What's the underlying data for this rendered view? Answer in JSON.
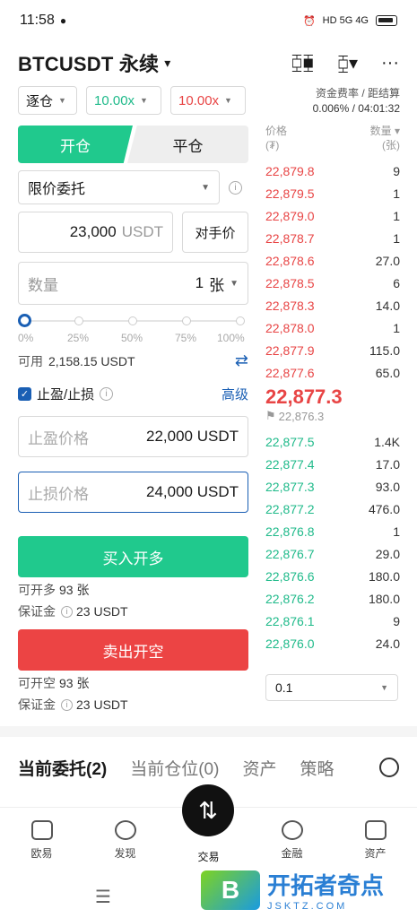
{
  "status_bar": {
    "time": "11:58",
    "indicators": "HD 5G 4G"
  },
  "header": {
    "pair": "BTCUSDT 永续",
    "caret": "▾"
  },
  "margin_mode": "逐仓",
  "leverage_long": "10.00x",
  "leverage_short": "10.00x",
  "tabs": {
    "open": "开仓",
    "close": "平仓"
  },
  "order_type": "限价委托",
  "price": {
    "value": "23,000",
    "unit": "USDT",
    "counter": "对手价"
  },
  "quantity": {
    "placeholder": "数量",
    "value": "1",
    "unit": "张"
  },
  "slider": {
    "labels": [
      "0%",
      "25%",
      "50%",
      "75%",
      "100%"
    ],
    "level": 0
  },
  "available": {
    "label": "可用",
    "value": "2,158.15 USDT"
  },
  "tpsl": {
    "label": "止盈/止损",
    "advanced": "高级"
  },
  "take_profit": {
    "placeholder": "止盈价格",
    "value": "22,000 USDT"
  },
  "stop_loss": {
    "placeholder": "止损价格",
    "value": "24,000 USDT"
  },
  "buy": {
    "label": "买入开多",
    "can_open_label": "可开多",
    "can_open_value": "93 张",
    "margin_label": "保证金",
    "margin_value": "23 USDT"
  },
  "sell": {
    "label": "卖出开空",
    "can_open_label": "可开空",
    "can_open_value": "93 张",
    "margin_label": "保证金",
    "margin_value": "23 USDT"
  },
  "funding": {
    "label": "资金费率 / 距结算",
    "value": "0.006% / 04:01:32"
  },
  "orderbook": {
    "price_header": "价格",
    "price_unit": "(₮)",
    "qty_header": "数量 ▾",
    "qty_unit": "(张)",
    "asks": [
      {
        "p": "22,879.8",
        "q": "9"
      },
      {
        "p": "22,879.5",
        "q": "1"
      },
      {
        "p": "22,879.0",
        "q": "1"
      },
      {
        "p": "22,878.7",
        "q": "1"
      },
      {
        "p": "22,878.6",
        "q": "27.0"
      },
      {
        "p": "22,878.5",
        "q": "6"
      },
      {
        "p": "22,878.3",
        "q": "14.0"
      },
      {
        "p": "22,878.0",
        "q": "1"
      },
      {
        "p": "22,877.9",
        "q": "115.0"
      },
      {
        "p": "22,877.6",
        "q": "65.0"
      }
    ],
    "last_price": "22,877.3",
    "mark_price": "22,876.3",
    "bids": [
      {
        "p": "22,877.5",
        "q": "1.4K"
      },
      {
        "p": "22,877.4",
        "q": "17.0"
      },
      {
        "p": "22,877.3",
        "q": "93.0"
      },
      {
        "p": "22,877.2",
        "q": "476.0"
      },
      {
        "p": "22,876.8",
        "q": "1"
      },
      {
        "p": "22,876.7",
        "q": "29.0"
      },
      {
        "p": "22,876.6",
        "q": "180.0"
      },
      {
        "p": "22,876.2",
        "q": "180.0"
      },
      {
        "p": "22,876.1",
        "q": "9"
      },
      {
        "p": "22,876.0",
        "q": "24.0"
      }
    ],
    "depth": "0.1"
  },
  "bottom_tabs": [
    "当前委托(2)",
    "当前仓位(0)",
    "资产",
    "策略"
  ],
  "nav": [
    "欧易",
    "发现",
    "交易",
    "金融",
    "资产"
  ],
  "watermark": {
    "logo": "B",
    "text": "开拓者奇点",
    "url": "JSKTZ.COM"
  },
  "colors": {
    "green": "#20c98d",
    "red": "#ec4444",
    "blue": "#1a5fb4"
  }
}
